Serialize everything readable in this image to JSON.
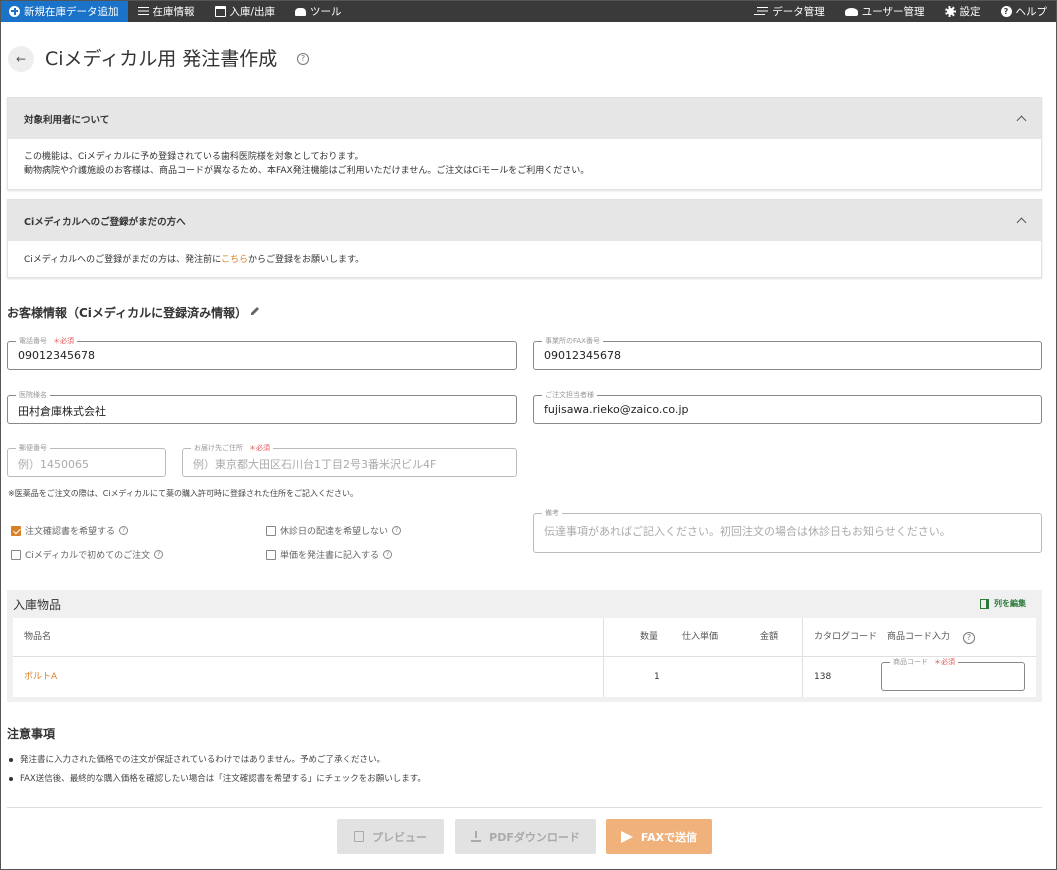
{
  "nav": {
    "new_item": "新規在庫データ追加",
    "inventory": "在庫情報",
    "in_out": "入庫/出庫",
    "tools": "ツール",
    "data_mgmt": "データ管理",
    "user_mgmt": "ユーザー管理",
    "settings": "設定",
    "help": "ヘルプ"
  },
  "page": {
    "back_icon": "arrow-left-icon",
    "title": "Ciメディカル用 発注書作成",
    "help_glyph": "?"
  },
  "accordion1": {
    "title": "対象利用者について",
    "line1": "この機能は、Ciメディカルに予め登録されている歯科医院様を対象としております。",
    "line2": "動物病院や介護施設のお客様は、商品コードが異なるため、本FAX発注機能はご利用いただけません。ご注文はCiモールをご利用ください。"
  },
  "accordion2": {
    "title": "Ciメディカルへのご登録がまだの方へ",
    "text_before": "Ciメディカルへのご登録がまだの方は、発注前に",
    "link": "こちら",
    "text_after": "からご登録をお願いします。"
  },
  "customer": {
    "title": "お客様情報（Ciメディカルに登録済み情報）",
    "phone_label": "電話番号",
    "phone_req": "＊必須",
    "phone_value": "09012345678",
    "fax_label": "事業所のFAX番号",
    "fax_value": "09012345678",
    "clinic_label": "医院様名",
    "clinic_value": "田村倉庫株式会社",
    "contact_label": "ご注文担当者様",
    "contact_value": "fujisawa.rieko@zaico.co.jp",
    "zip_label": "郵便番号",
    "zip_placeholder": "例）1450065",
    "address_label": "お届け先ご住所",
    "address_req": "＊必須",
    "address_placeholder": "例）東京都大田区石川台1丁目2号3番米沢ビル4F",
    "note": "※医薬品をご注文の際は、Ciメディカルにて薬の購入許可時に登録された住所をご記入ください。"
  },
  "options": {
    "confirm_label": "注文確認書を希望する",
    "holiday_label": "休診日の配達を希望しない",
    "first_label": "Ciメディカルで初めてのご注文",
    "price_label": "単価を発注書に記入する",
    "memo_label": "備考",
    "memo_placeholder": "伝達事項があればご記入ください。初回注文の場合は休診日もお知らせください。"
  },
  "items": {
    "title": "入庫物品",
    "edit_columns": "列を編集",
    "headers": {
      "name": "物品名",
      "qty": "数量",
      "unit_price": "仕入単価",
      "amount": "金額",
      "catalog": "カタログコード",
      "code_input": "商品コード入力"
    },
    "rows": [
      {
        "name": "ボルトA",
        "qty": "1",
        "catalog": "138",
        "code_label": "商品コード",
        "code_req": "＊必須"
      }
    ]
  },
  "notes": {
    "title": "注意事項",
    "items": [
      "発注書に入力された価格での注文が保証されているわけではありません。予めご了承ください。",
      "FAX送信後、最終的な購入価格を確認したい場合は「注文確認書を希望する」にチェックをお願いします。"
    ]
  },
  "buttons": {
    "preview": "プレビュー",
    "pdf": "PDFダウンロード",
    "fax": "FAXで送信"
  },
  "colors": {
    "nav_bg": "#3a3a3a",
    "nav_primary": "#1a73c9",
    "accent": "#d8812b",
    "fax_button": "#f0b27a"
  }
}
